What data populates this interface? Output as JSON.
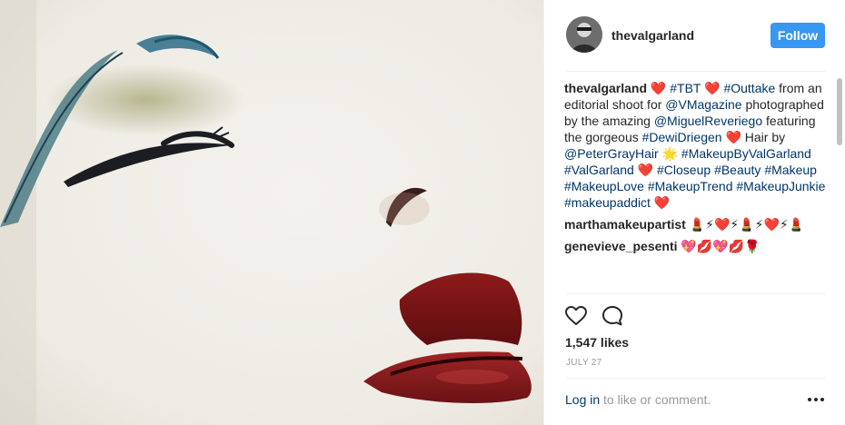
{
  "post": {
    "username": "thevalgarland",
    "follow_label": "Follow"
  },
  "caption": {
    "user": "thevalgarland",
    "heart": "❤️",
    "tag_tbt": "#TBT",
    "tag_outtake": "#Outtake",
    "text_1": "from an editorial shoot for",
    "mention_vmagazine": "@VMagazine",
    "text_2": "photographed by the amazing",
    "mention_miguel": "@MiguelReveriego",
    "text_3": "featuring the gorgeous",
    "tag_dewi": "#DewiDriegen",
    "text_4": "Hair by",
    "mention_peter": "@PeterGrayHair",
    "sparkle": "🌟",
    "tag_makeupbyval": "#MakeupByValGarland",
    "tag_valgarland": "#ValGarland",
    "tag_closeup": "#Closeup",
    "tag_beauty": "#Beauty",
    "tag_makeup": "#Makeup",
    "tag_makeuplove": "#MakeupLove",
    "tag_makeuptrend": "#MakeupTrend",
    "tag_makeupjunkie": "#MakeupJunkie",
    "tag_makeupaddict": "#makeupaddict"
  },
  "comments": [
    {
      "user": "marthamakeupartist",
      "text": "💄⚡❤️⚡💄⚡❤️⚡💄"
    },
    {
      "user": "genevieve_pesenti",
      "text": "💖💋💖💋🌹"
    }
  ],
  "stats": {
    "likes": "1,547 likes",
    "date": "JULY 27"
  },
  "footer": {
    "login_link": "Log in",
    "login_suffix": " to like or comment.",
    "more": "•••"
  },
  "icons": {
    "like": "heart-outline-icon",
    "comment": "speech-bubble-icon",
    "more": "ellipsis-icon"
  },
  "colors": {
    "accent": "#3897f0",
    "link": "#003569",
    "muted": "#999999"
  }
}
